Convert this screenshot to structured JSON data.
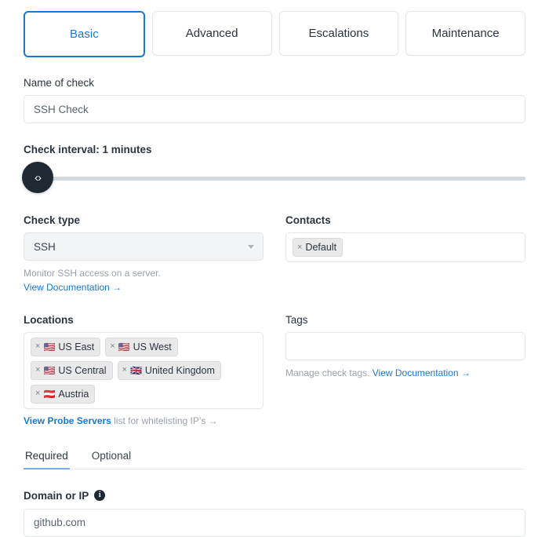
{
  "top_tabs": [
    {
      "label": "Basic",
      "active": true
    },
    {
      "label": "Advanced",
      "active": false
    },
    {
      "label": "Escalations",
      "active": false
    },
    {
      "label": "Maintenance",
      "active": false
    }
  ],
  "name_of_check": {
    "label": "Name of check",
    "value": "SSH Check"
  },
  "check_interval": {
    "label": "Check interval: 1 minutes",
    "handle_glyph": "‹›",
    "value": 1,
    "unit": "minutes"
  },
  "check_type": {
    "label": "Check type",
    "value": "SSH",
    "helper": "Monitor SSH access on a server.",
    "doc_link": "View Documentation →"
  },
  "contacts": {
    "label": "Contacts",
    "chips": [
      {
        "remove": "×",
        "label": "Default"
      }
    ]
  },
  "locations": {
    "label": "Locations",
    "chips": [
      {
        "remove": "×",
        "flag": "🇺🇸",
        "label": "US East"
      },
      {
        "remove": "×",
        "flag": "🇺🇸",
        "label": "US West"
      },
      {
        "remove": "×",
        "flag": "🇺🇸",
        "label": "US Central"
      },
      {
        "remove": "×",
        "flag": "🇬🇧",
        "label": "United Kingdom"
      },
      {
        "remove": "×",
        "flag": "🇦🇹",
        "label": "Austria"
      }
    ],
    "foot_link": "View Probe Servers",
    "foot_text": " list for whitelisting IP’s →"
  },
  "tags": {
    "label": "Tags",
    "value": "",
    "helper_text": "Manage check tags. ",
    "doc_link": "View Documentation →"
  },
  "sub_tabs": [
    {
      "label": "Required",
      "active": true
    },
    {
      "label": "Optional",
      "active": false
    }
  ],
  "domain": {
    "label": "Domain or IP",
    "info_icon": "i",
    "value": "github.com"
  },
  "colors": {
    "accent": "#1878d4",
    "text": "#2b3440",
    "muted": "#9aa1ab",
    "handle": "#1f2933",
    "track": "#d3d9e0",
    "underline": "#76aee4"
  }
}
